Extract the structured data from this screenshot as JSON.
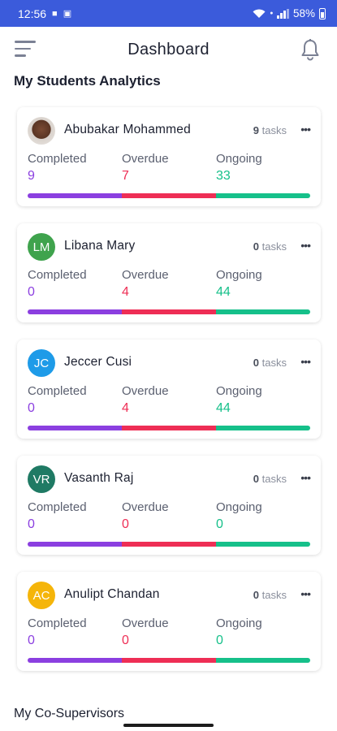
{
  "status_bar": {
    "time": "12:56",
    "battery": "58%",
    "icons": [
      "sim-icon",
      "sd-card-icon",
      "wifi-icon",
      "volte-icon",
      "signal-icon",
      "battery-icon"
    ]
  },
  "app_bar": {
    "title": "Dashboard",
    "icons": [
      "menu-icon",
      "bell-icon"
    ]
  },
  "section_title": "My Students Analytics",
  "stat_labels": {
    "completed": "Completed",
    "overdue": "Overdue",
    "ongoing": "Ongoing"
  },
  "colors": {
    "statusbar": "#3b5bdb",
    "completed": "#8b3fe0",
    "overdue": "#ee2e55",
    "ongoing": "#16c08a"
  },
  "students": [
    {
      "name": "Abubakar Mohammed",
      "initials": "",
      "avatar_type": "photo",
      "avatar_color": "",
      "tasks_count": "9",
      "tasks_label": "tasks",
      "completed": "9",
      "overdue": "7",
      "ongoing": "33"
    },
    {
      "name": "Libana Mary",
      "initials": "LM",
      "avatar_type": "initials",
      "avatar_color": "#3fa34d",
      "tasks_count": "0",
      "tasks_label": "tasks",
      "completed": "0",
      "overdue": "4",
      "ongoing": "44"
    },
    {
      "name": "Jeccer Cusi",
      "initials": "JC",
      "avatar_type": "initials",
      "avatar_color": "#1e9be8",
      "tasks_count": "0",
      "tasks_label": "tasks",
      "completed": "0",
      "overdue": "4",
      "ongoing": "44"
    },
    {
      "name": "Vasanth Raj",
      "initials": "VR",
      "avatar_type": "initials",
      "avatar_color": "#1f7a64",
      "tasks_count": "0",
      "tasks_label": "tasks",
      "completed": "0",
      "overdue": "0",
      "ongoing": "0"
    },
    {
      "name": "Anulipt Chandan",
      "initials": "AC",
      "avatar_type": "initials",
      "avatar_color": "#f5b50a",
      "tasks_count": "0",
      "tasks_label": "tasks",
      "completed": "0",
      "overdue": "0",
      "ongoing": "0"
    }
  ],
  "section_2_title": "My Co-Supervisors"
}
